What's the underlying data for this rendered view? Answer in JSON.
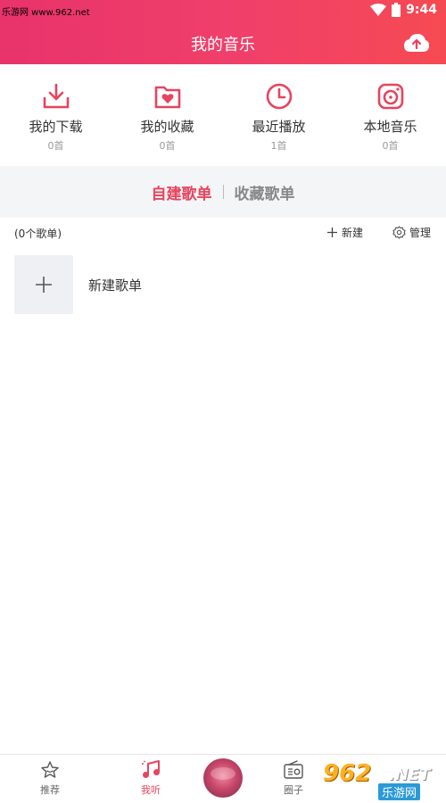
{
  "status": {
    "watermark": "乐游网 www.962.net",
    "time": "9:44"
  },
  "header": {
    "title": "我的音乐",
    "upload_icon": "cloud-upload-icon"
  },
  "quick_actions": [
    {
      "label": "我的下载",
      "count": "0首",
      "icon": "download-icon"
    },
    {
      "label": "我的收藏",
      "count": "0首",
      "icon": "favorite-folder-icon"
    },
    {
      "label": "最近播放",
      "count": "1首",
      "icon": "clock-icon"
    },
    {
      "label": "本地音乐",
      "count": "0首",
      "icon": "vinyl-icon"
    }
  ],
  "tabs": {
    "created": "自建歌单",
    "collected": "收藏歌单",
    "active": "created"
  },
  "list": {
    "count_text": "(0个歌单)",
    "new_label": "新建",
    "manage_label": "管理"
  },
  "new_playlist": {
    "label": "新建歌单"
  },
  "nav": {
    "recommend": "推荐",
    "listen": "我听",
    "circle": "圈子"
  },
  "logo": {
    "main": "962",
    "net": ".NET",
    "sub": "乐游网"
  },
  "colors": {
    "accent": "#e8445e",
    "header_start": "#e8336b",
    "header_end": "#f64a52",
    "tab_bg": "#f4f5f7"
  }
}
